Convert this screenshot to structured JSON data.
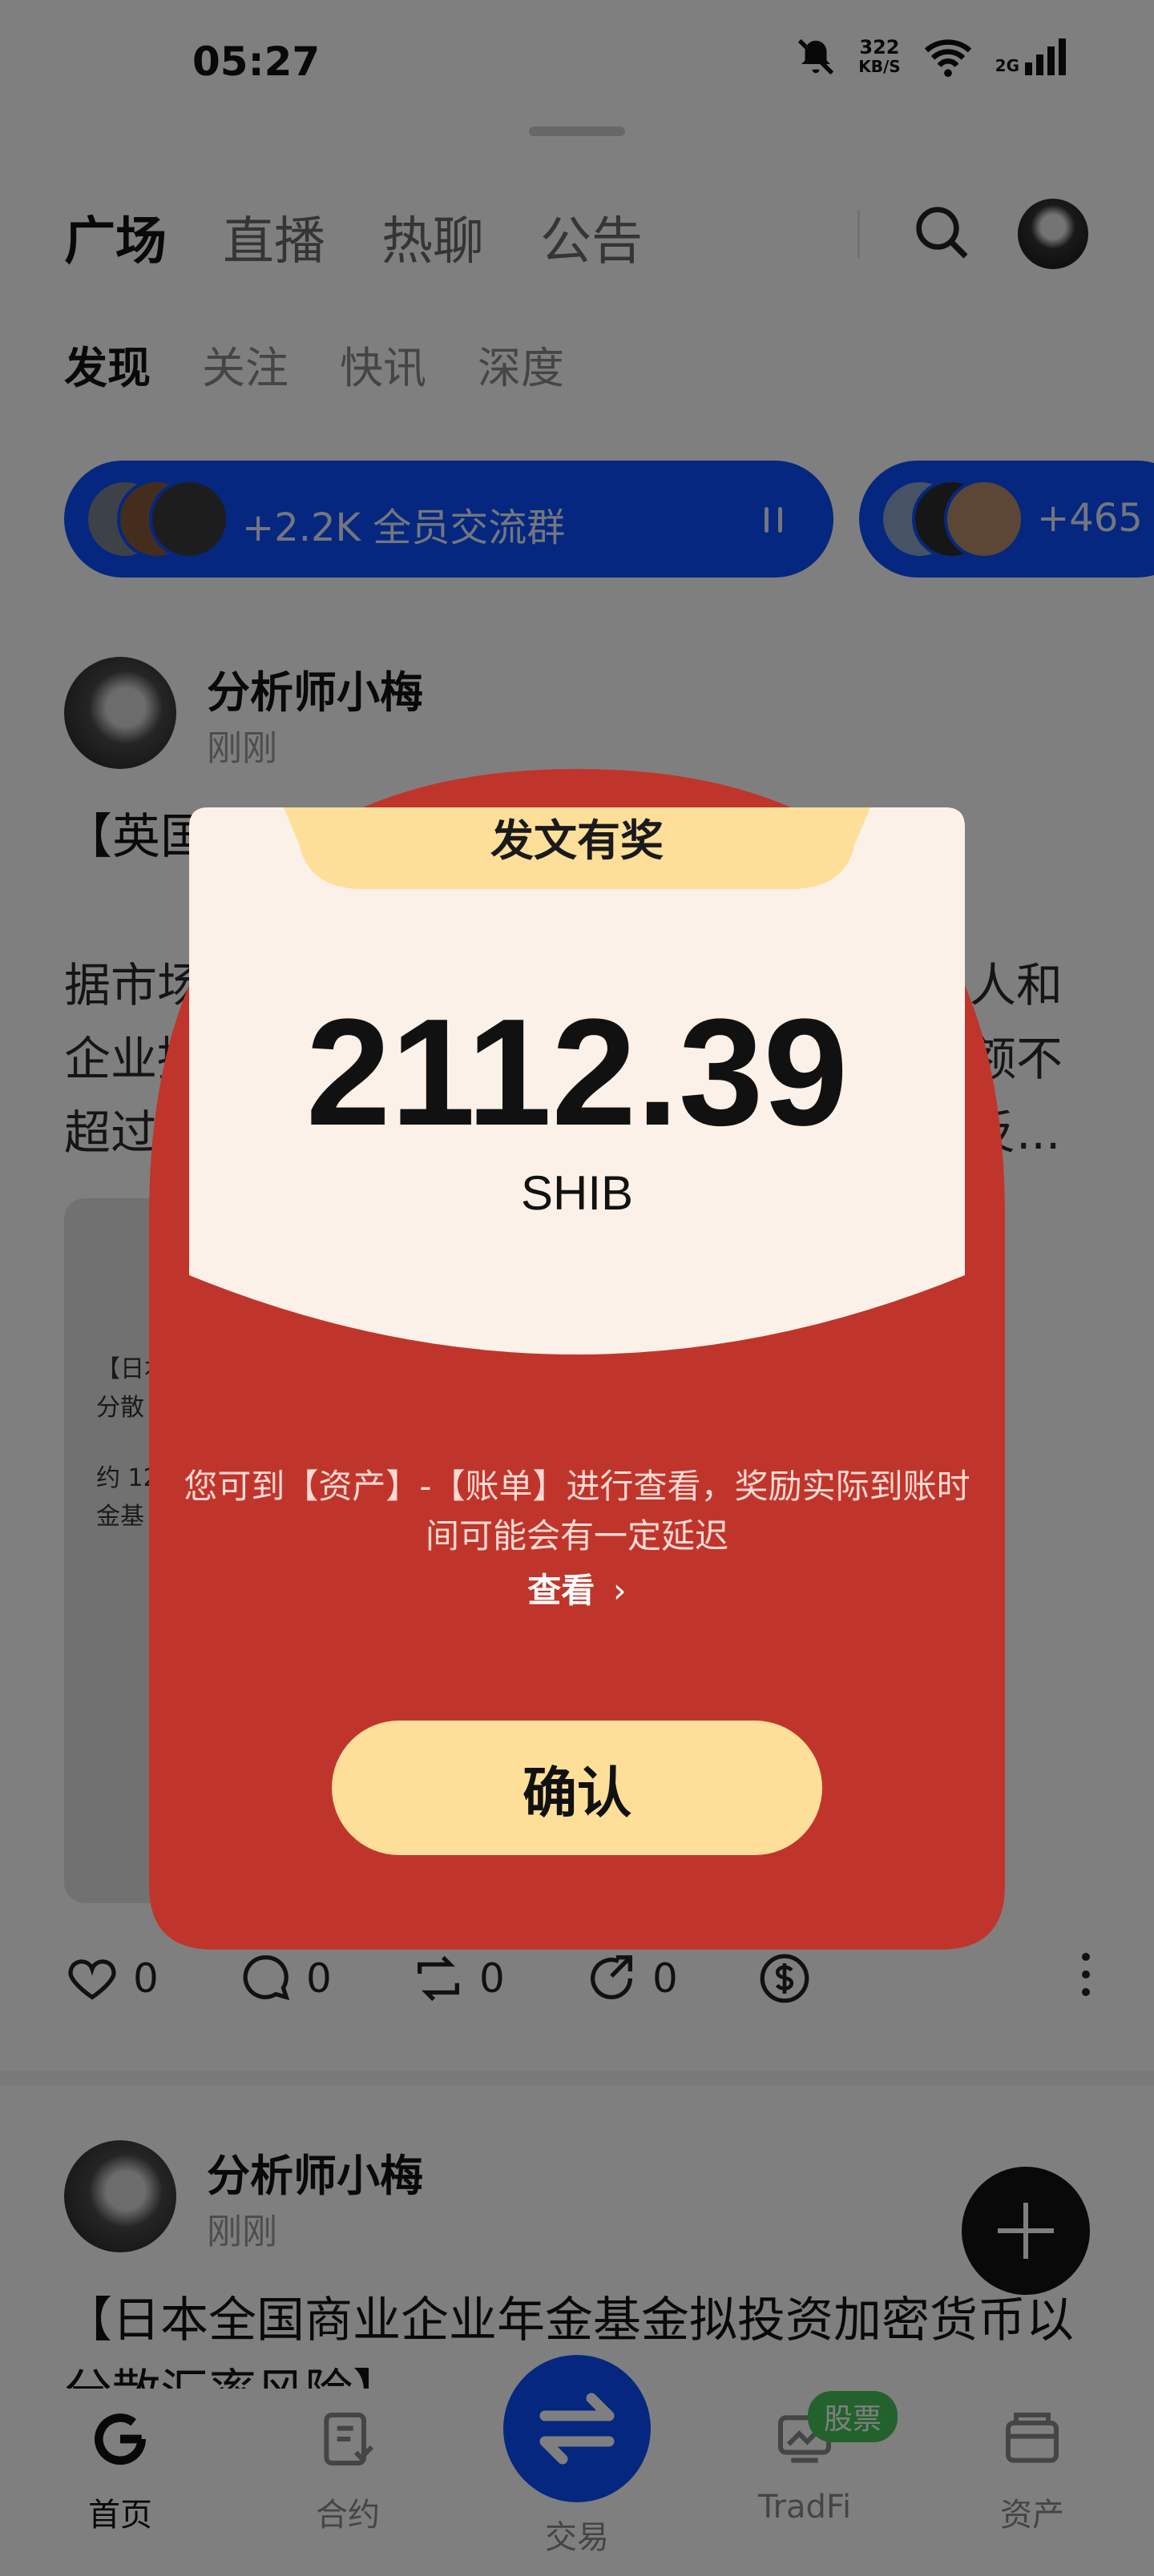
{
  "status_bar": {
    "time": "05:27",
    "net_speed": "322",
    "net_unit": "KB/S",
    "signal_label": "2G"
  },
  "header": {
    "tabs": [
      "广场",
      "直播",
      "热聊",
      "公告"
    ],
    "subtabs": [
      "发现",
      "关注",
      "快讯",
      "深度"
    ]
  },
  "groups": [
    {
      "label": "+2.2K 全员交流群"
    },
    {
      "label": "+465"
    }
  ],
  "posts": [
    {
      "author": "分析师小梅",
      "time": "刚刚",
      "title": "【英国",
      "body": [
        "据市场",
        "企业持",
        "超过"
      ],
      "body_right": [
        "人和",
        "额不",
        "反..."
      ],
      "preview_snippets": [
        "【日本",
        "分散",
        "约 12",
        "金基"
      ]
    },
    {
      "author": "分析师小梅",
      "time": "刚刚",
      "title": "【日本全国商业企业年金基金拟投资加密货币以分散汇率风险】"
    }
  ],
  "actions": {
    "like": "0",
    "comment": "0",
    "repost": "0",
    "share": "0"
  },
  "bottom_nav": {
    "home": "首页",
    "contract": "合约",
    "trade": "交易",
    "tradfi": "TradFi",
    "stock_badge": "股票",
    "assets": "资产"
  },
  "reward_modal": {
    "title": "发文有奖",
    "amount": "2112.39",
    "currency": "SHIB",
    "notice": "您可到【资产】-【账单】进行查看，奖励实际到账时间可能会有一定延迟",
    "view_link": "查看",
    "confirm": "确认",
    "colors": {
      "red": "#C0352B",
      "cream": "#FCF1E8",
      "gold": "#FEDF9A"
    }
  }
}
